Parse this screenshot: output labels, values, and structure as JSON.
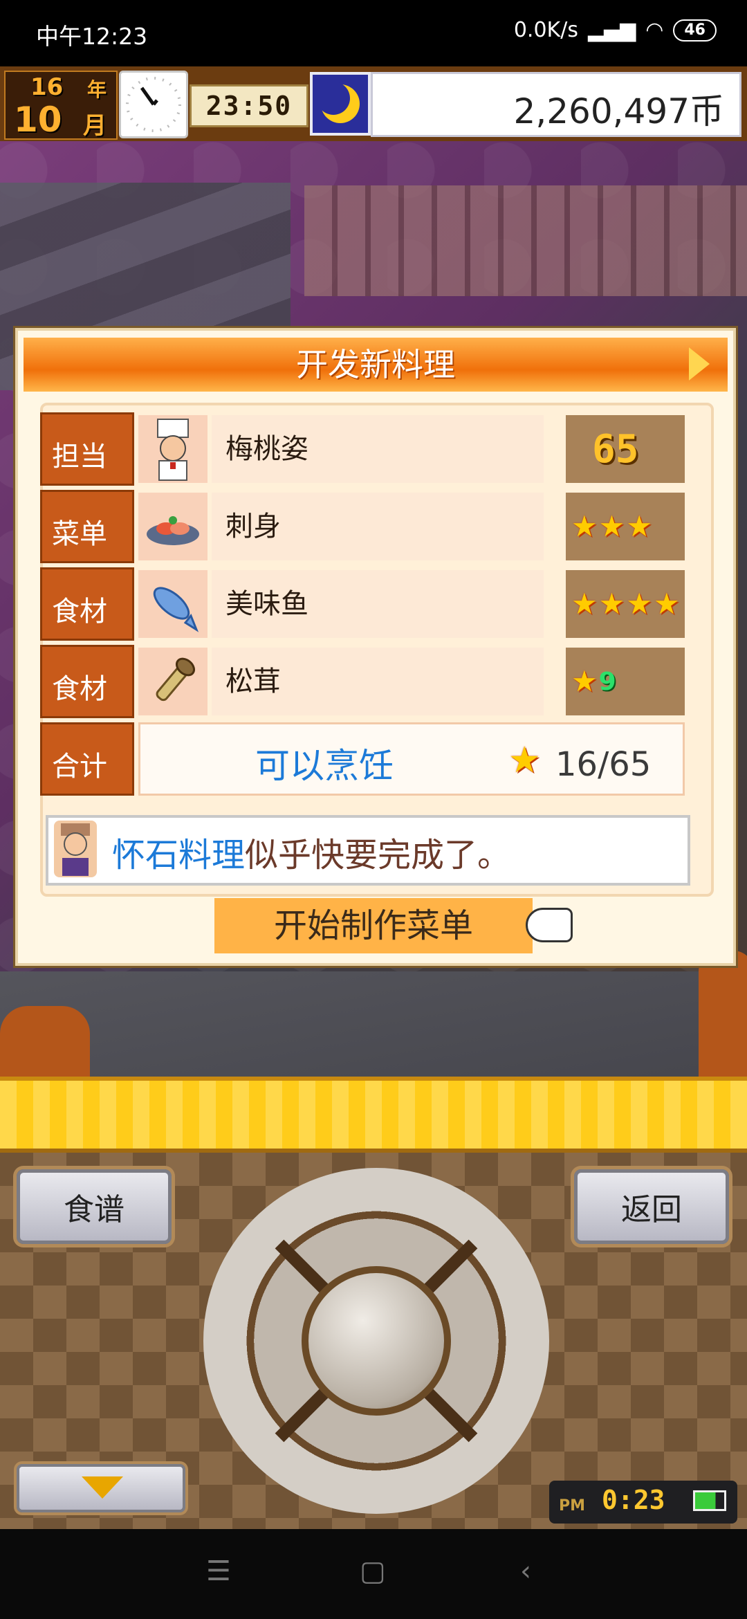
{
  "status_bar": {
    "time": "中午12:23",
    "network_speed": "0.0K/s",
    "battery": "46"
  },
  "hud": {
    "year": "16",
    "year_unit": "年",
    "month": "10",
    "month_unit": "月",
    "time": "23:50",
    "money": "2,260,497币"
  },
  "dialog": {
    "title": "开发新料理",
    "rows": [
      {
        "label": "担当",
        "name": "梅桃姿",
        "rating_text": "65",
        "icon": "chef-icon"
      },
      {
        "label": "菜单",
        "name": "刺身",
        "stars": 3,
        "icon": "sashimi-icon"
      },
      {
        "label": "食材",
        "name": "美味鱼",
        "stars": 4,
        "icon": "fish-icon"
      },
      {
        "label": "食材",
        "name": "松茸",
        "stars": 1,
        "star_rank": "9",
        "icon": "matsutake-icon"
      }
    ],
    "total": {
      "label": "合计",
      "status": "可以烹饪",
      "score": "16/65"
    },
    "message": {
      "highlight": "怀石料理",
      "text": "似乎快要完成了。"
    },
    "start_button": "开始制作菜单"
  },
  "controls": {
    "left_button": "食谱",
    "right_button": "返回",
    "mini_clock_period": "PM",
    "mini_clock_time": "0:23"
  },
  "colors": {
    "accent_orange": "#f0700a",
    "highlight_blue": "#1c7ad8",
    "label_bg": "#c85a1a"
  }
}
